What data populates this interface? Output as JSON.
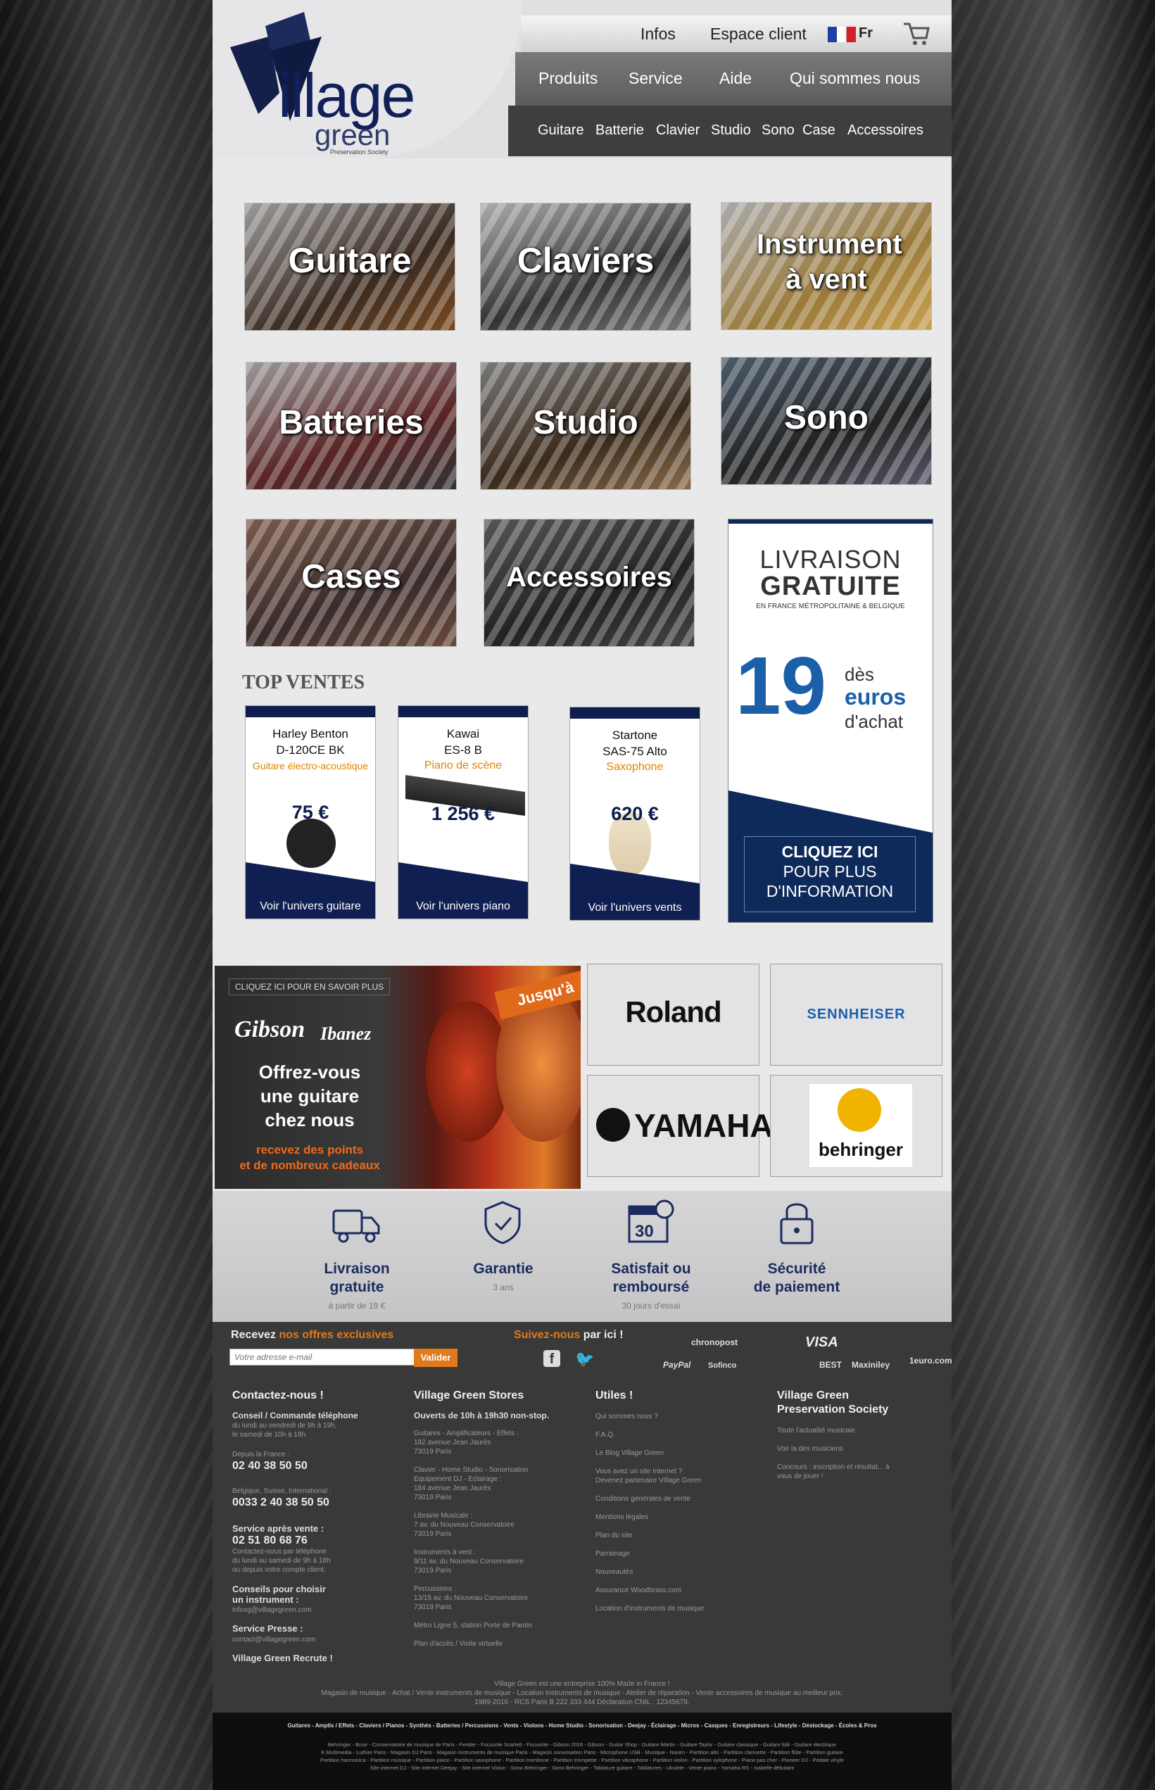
{
  "header": {
    "logo_text": "illage",
    "logo_sub": "green",
    "logo_small": "Preservation Society",
    "top_links": [
      "Infos",
      "Espace client"
    ],
    "language": "Fr",
    "nav_main": [
      "Produits",
      "Service",
      "Aide",
      "Qui sommes nous"
    ],
    "nav_sub": [
      "Guitare",
      "Batterie",
      "Clavier",
      "Studio",
      "Sono",
      "Case",
      "Accessoires"
    ]
  },
  "categories": [
    "Guitare",
    "Claviers",
    "Instrument à vent",
    "Batteries",
    "Studio",
    "Sono",
    "Cases",
    "Accessoires"
  ],
  "top_ventes": {
    "title": "TOP VENTES",
    "products": [
      {
        "brand": "Harley Benton",
        "model": "D-120CE BK",
        "category": "Guitare électro-acoustique",
        "price": "75 €",
        "link": "Voir l'univers guitare"
      },
      {
        "brand": "Kawai",
        "model": "ES-8 B",
        "category": "Piano de scène",
        "price": "1 256 €",
        "link": "Voir l'univers piano"
      },
      {
        "brand": "Startone",
        "model": "SAS-75 Alto",
        "category": "Saxophone",
        "price": "620 €",
        "link": "Voir l'univers vents"
      }
    ]
  },
  "livraison": {
    "line1": "LIVRAISON",
    "line2": "GRATUITE",
    "sub": "EN FRANCE MÉTROPOLITAINE & BELGIQUE",
    "big": "19",
    "des": "dès",
    "euros": "euros",
    "achat": "d'achat",
    "cta1": "CLIQUEZ ICI",
    "cta2": "POUR PLUS",
    "cta3": "D'INFORMATION"
  },
  "promo": {
    "top": "CLIQUEZ ICI POUR EN SAVOIR PLUS",
    "brand1": "Gibson",
    "brand2": "Ibanez",
    "jusqua": "Jusqu'à",
    "headline1": "Offrez-vous",
    "headline2": "une guitare",
    "headline3": "chez nous",
    "sub1": "recevez des points",
    "sub2": "et de nombreux cadeaux"
  },
  "brands": [
    "Roland",
    "SENNHEISER",
    "YAMAHA",
    "behringer"
  ],
  "services": [
    {
      "title1": "Livraison",
      "title2": "gratuite",
      "sub": "à partir de 19 €"
    },
    {
      "title1": "Garantie",
      "title2": "",
      "sub": "3 ans"
    },
    {
      "title1": "Satisfait ou",
      "title2": "remboursé",
      "sub": "30 jours d'essai"
    },
    {
      "title1": "Sécurité",
      "title2": "de paiement",
      "sub": ""
    }
  ],
  "footer": {
    "newsletter_pre": "Recevez",
    "newsletter_hl": "nos offres exclusives",
    "email_placeholder": "Votre adresse e-mail",
    "valider": "Valider",
    "follow_hl": "Suivez-nous",
    "follow_post": "par ici !",
    "payments": [
      "chronopost",
      "VISA",
      "PayPal",
      "Sofinco",
      "BEST",
      "Maxiniley",
      "1euro.com"
    ],
    "contact_title": "Contactez-nous !",
    "contact_conseil": "Conseil / Commande téléphone",
    "contact_hours1": "du lundi au vendredi de 9h à 19h,",
    "contact_hours2": "le samedi de 10h à 18h.",
    "contact_fr_label": "Depuis la France :",
    "contact_fr": "02 40 38 50 50",
    "contact_int_label": "Belgique, Suisse, International :",
    "contact_int": "0033 2 40 38 50 50",
    "sav_title": "Service après vente :",
    "sav_phone": "02 51 80 68 76",
    "sav_text1": "Contactez-nous par téléphone",
    "sav_text2": "du lundi au samedi de 9h à 18h",
    "sav_text3": "ou depuis votre compte client.",
    "conseils_title1": "Conseils pour choisir",
    "conseils_title2": "un instrument :",
    "conseils_mail": "infoxg@villagegreen.com",
    "presse_title": "Service Presse :",
    "presse_mail": "contact@villagegreen.com",
    "recrute": "Village Green Recrute !",
    "stores_title": "Village Green Stores",
    "stores_hours": "Ouverts de 10h à 19h30 non-stop.",
    "stores": [
      "Guitares - Amplificateurs - Effets :",
      "182 avenue Jean Jaurès",
      "73019 Paris",
      "",
      "Clavier - Home Studio - Sonorisation",
      "Equipement DJ - Eclairage :",
      "184 avenue Jean Jaurès",
      "73019 Paris",
      "",
      "Librairie Musicale :",
      "7 av. du Nouveau Conservatoire",
      "73019 Paris",
      "",
      "Instruments à vent :",
      "9/11 av. du Nouveau Conservatoire",
      "73019 Paris",
      "",
      "Percussions :",
      "13/15 av. du Nouveau Conservatoire",
      "73019 Paris",
      "",
      "Métro Ligne 5, station Porte de Pantin",
      "",
      "Plan d'accès / Visite virtuelle"
    ],
    "utiles_title": "Utiles !",
    "utiles": [
      "Qui sommes nous ?",
      "F.A.Q.",
      "Le Blog Village Green",
      "Vous avez un site Internet ?",
      "Devenez partenaire Village Green",
      "Conditions générales de vente",
      "Mentions légales",
      "Plan du site",
      "Parrainage",
      "Nouveautés",
      "Assurance Woodbrass.com",
      "Location d'instruments de musique"
    ],
    "society_title1": "Village Green",
    "society_title2": "Preservation Society",
    "society": [
      "Toute l'actualité musicale",
      "Voir la des musiciens",
      "Concours : inscription et résultat... à vous de jouer !"
    ],
    "legal1": "Village Green est une entreprise 100% Made in France !",
    "legal2": "Magasin de musique - Achat / Vente instruments de musique - Location instruments de musique - Atelier de réparation - Vente accessoires de musique au meilleur prix.",
    "legal3": "1989-2016 - RCS Paris B 222 333 444 Déclaration CNIL : 12345678.",
    "bottom_cats": "Guitares - Amplis / Effets - Claviers / Pianos - Synthés - Batteries / Percussions - Vents - Violons - Home Studio - Sonorisation - Deejay - Éclairage - Micros - Casques - Enregistreurs - Lifestyle - Déstockage - Écoles & Pros",
    "bottom_brands1": "Behringer - Bose - Conservatoire de musique de Paris - Fender - Focusrite Scarlett - Focusrite - Gibson 2016 - Gibson - Guitar Shop - Guitare Martin - Guitare Taylor - Guitare classique - Guitare folk - Guitare électrique",
    "bottom_brands2": "K Multimedia - Luthier Paris - Magasin DJ Paris - Magasin instruments de musique Paris - Magasin sonorisation Paris - Microphone USB - Musique - Nanim - Partition alto - Partition clarinette - Partition flûte - Partition guitare",
    "bottom_brands3": "Partition harmonica - Partition musique - Partition piano - Partition saxophone - Partition trombone - Partition trompette - Partition vibraphone - Partition violon - Partition xylophone - Piano pas cher - Pioneer DJ - Pédale vinyle",
    "bottom_brands4": "Site internet DJ - Site internet Deejay - Site internet Violon - Sono Behringer - Sono Behringer - Tablature guitare - Tablatures - Ukulele - Vente piano - Yamaha RS - Isabelle débutant"
  }
}
